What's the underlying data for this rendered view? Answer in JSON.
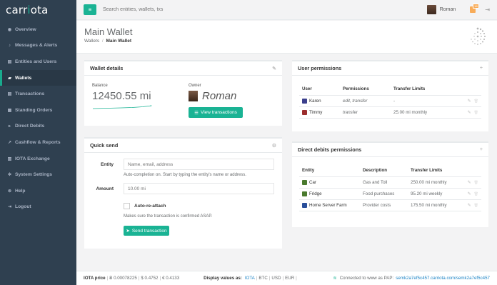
{
  "app": {
    "logo_prefix": "carr",
    "logo_mark": "i",
    "logo_suffix": "ota"
  },
  "sidebar": {
    "items": [
      {
        "label": "Overview",
        "icon": "dashboard-icon",
        "glyph": "◉",
        "active": false
      },
      {
        "label": "Messages & Alerts",
        "icon": "bell-icon",
        "glyph": "♪",
        "active": false
      },
      {
        "label": "Entities and Users",
        "icon": "address-book-icon",
        "glyph": "▤",
        "active": false
      },
      {
        "label": "Wallets",
        "icon": "folder-open-icon",
        "glyph": "▰",
        "active": true
      },
      {
        "label": "Transactions",
        "icon": "list-alt-icon",
        "glyph": "▤",
        "active": false
      },
      {
        "label": "Standing Orders",
        "icon": "calendar-icon",
        "glyph": "▦",
        "active": false
      },
      {
        "label": "Direct Debits",
        "icon": "flag-icon",
        "glyph": "▸",
        "active": false
      },
      {
        "label": "Cashflow & Reports",
        "icon": "chart-icon",
        "glyph": "↗",
        "active": false
      },
      {
        "label": "IOTA Exchange",
        "icon": "bar-chart-icon",
        "glyph": "▥",
        "active": false
      },
      {
        "label": "System Settings",
        "icon": "cogs-icon",
        "glyph": "✲",
        "active": false
      },
      {
        "label": "Help",
        "icon": "life-ring-icon",
        "glyph": "⊚",
        "active": false
      },
      {
        "label": "Logout",
        "icon": "sign-out-icon",
        "glyph": "⇥",
        "active": false
      }
    ]
  },
  "topbar": {
    "menu_glyph": "≡",
    "search_placeholder": "Search entities, wallets, txs",
    "user_name": "Roman",
    "notification_count": "18",
    "logout_glyph": "⇥"
  },
  "heading": {
    "title": "Main Wallet",
    "breadcrumb_parent": "Wallets",
    "breadcrumb_sep": "/",
    "breadcrumb_current": "Main Wallet"
  },
  "wallet_details": {
    "title": "Wallet details",
    "balance_label": "Balance",
    "balance_value": "12450.55 mi",
    "owner_label": "Owner",
    "owner_name": "Roman",
    "view_button": "View transactions",
    "tool_glyph": "✎"
  },
  "quick_send": {
    "title": "Quick send",
    "tool_glyph": "⚙",
    "entity_label": "Entity",
    "entity_placeholder": "Name, email, address",
    "entity_help": "Auto-completion on. Start by typing the entity's name or address.",
    "amount_label": "Amount",
    "amount_placeholder": "10.00 mi",
    "reattach_label": "Auto-re-attach",
    "reattach_help": "Makes sure the transaction is confirmed ASAP.",
    "send_button": "Send transaction"
  },
  "user_permissions": {
    "title": "User permissions",
    "tool_glyph": "+",
    "columns": [
      "User",
      "Permissions",
      "Transfer Limits"
    ],
    "rows": [
      {
        "user": "Karen",
        "permissions": "edit, transfer",
        "limit": "-",
        "color": "#3b3f8c"
      },
      {
        "user": "Timmy",
        "permissions": "transfer",
        "limit": "25.00 mi monthly",
        "color": "#9b2d2d"
      }
    ]
  },
  "direct_debits": {
    "title": "Direct debits permissions",
    "tool_glyph": "+",
    "columns": [
      "Entity",
      "Description",
      "Transfer Limits"
    ],
    "rows": [
      {
        "entity": "Car",
        "description": "Gas and Toll",
        "limit": "250.00 mi monthly",
        "color": "#4a7a2e"
      },
      {
        "entity": "Fridge",
        "description": "Food purchases",
        "limit": "95.20 mi weekly",
        "color": "#4a7a2e"
      },
      {
        "entity": "Home Server Farm",
        "description": "Provider costs",
        "limit": "175.50 mi monthly",
        "color": "#2a4f9b"
      }
    ]
  },
  "row_actions": {
    "edit_glyph": "✎",
    "delete_glyph": "🗑"
  },
  "footer": {
    "price_label": "IOTA price",
    "sep": "|",
    "btc": "Ƀ 0.00078225",
    "usd": "$ 0.4752",
    "eur": "€ 0.4133",
    "display_label": "Display values as:",
    "unit_iota": "IOTA",
    "unit_btc": "BTC",
    "unit_usd": "USD",
    "unit_eur": "EUR",
    "connected_label": "Connected to www as PAP:",
    "pap_address": "semk2a7ef5c457.carriota.com/semk2a7ef5c457",
    "wifi_glyph": "≋"
  },
  "colors": {
    "accent": "#1ab394",
    "sidebar_bg": "#2f4050",
    "link": "#1c84c6"
  }
}
